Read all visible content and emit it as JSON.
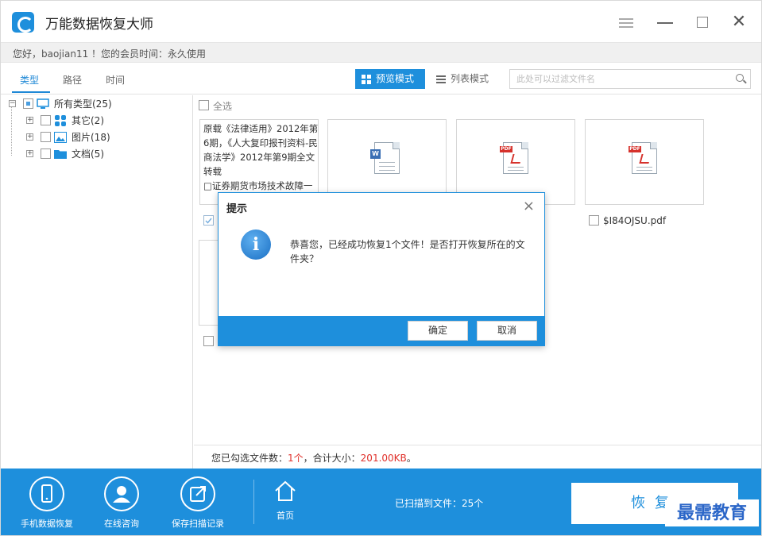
{
  "window": {
    "title": "万能数据恢复大师"
  },
  "greeting": {
    "text": "您好，baojian11 ！您的会员时间：永久使用"
  },
  "tabs": [
    {
      "label": "类型"
    },
    {
      "label": "路径"
    },
    {
      "label": "时间"
    }
  ],
  "view_modes": {
    "grid_label": "预览模式",
    "list_label": "列表模式"
  },
  "search": {
    "placeholder": "此处可以过滤文件名"
  },
  "tree": {
    "root": "所有类型(25)",
    "children": [
      {
        "label": "其它(2)"
      },
      {
        "label": "图片(18)"
      },
      {
        "label": "文档(5)"
      }
    ]
  },
  "content": {
    "select_all": "全选",
    "text_preview": "原载《法律适用》2012年第6期，《人大复印报刊资料-民商法学》2012年第9期全文转载\n□证券期货市场技术故障一",
    "file4_name": "$I84OJSU.pdf"
  },
  "status": {
    "prefix": "您已勾选文件数：",
    "count": "1个",
    "mid": "，合计大小：",
    "size": "201.00KB",
    "suffix": "。"
  },
  "bottom": {
    "phone_label": "手机数据恢复",
    "consult_label": "在线咨询",
    "save_label": "保存扫描记录",
    "home_label": "首页",
    "scanned": "已扫描到文件：25个",
    "recover": "恢复"
  },
  "dialog": {
    "title": "提示",
    "message": "恭喜您，已经成功恢复1个文件！是否打开恢复所在的文件夹？",
    "ok": "确定",
    "cancel": "取消"
  },
  "watermark": "最需教育",
  "colors": {
    "accent": "#1e8fdc",
    "highlight": "#e0302a"
  }
}
